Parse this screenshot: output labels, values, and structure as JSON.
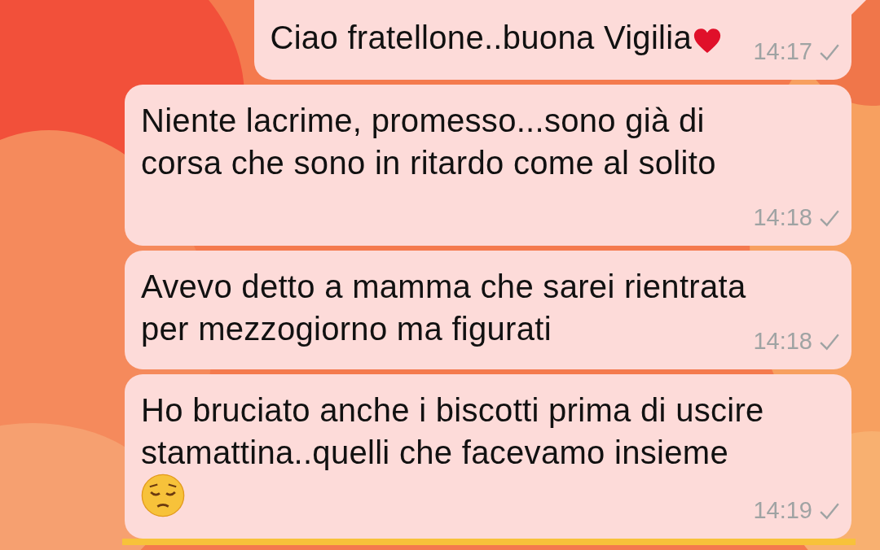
{
  "messages": [
    {
      "text": "Ciao fratellone..buona Vigilia",
      "kind": "heart",
      "time": "14:17",
      "tail": true
    },
    {
      "text": "Niente lacrime, promesso...sono già di\ncorsa che sono in ritardo come al solito\n",
      "kind": "plain",
      "time": "14:18",
      "tail": false
    },
    {
      "text": "Avevo detto a mamma che sarei rientrata\nper mezzogiorno ma figurati",
      "kind": "plain",
      "time": "14:18",
      "tail": false
    },
    {
      "text": "Ho bruciato anche i biscotti prima di uscire\nstamattina..quelli che facevamo insieme\n",
      "kind": "sad",
      "time": "14:19",
      "tail": false
    }
  ]
}
